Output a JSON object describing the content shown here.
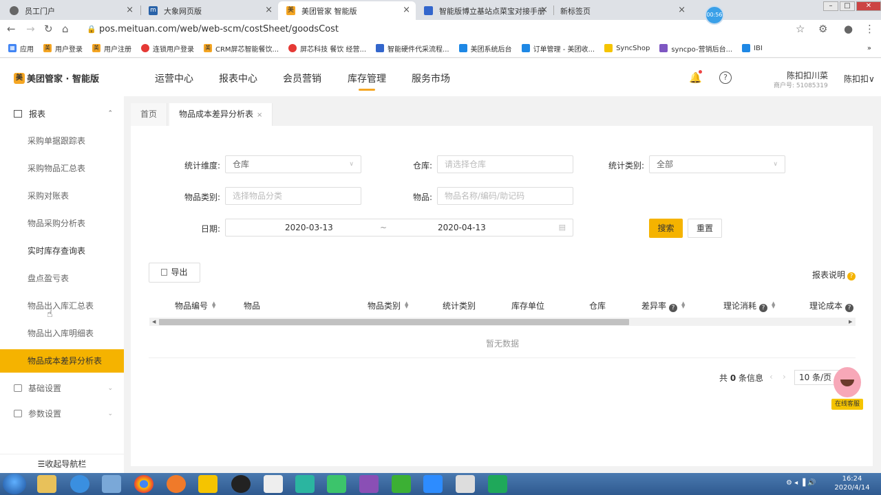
{
  "browser": {
    "tabs": [
      {
        "title": "员工门户"
      },
      {
        "title": "大象网页版"
      },
      {
        "title": "美团管家 智能版"
      },
      {
        "title": "智能版博立基站点菜宝对接手册"
      },
      {
        "title": "新标签页"
      }
    ],
    "timer": "00:56",
    "url": "pos.meituan.com/web/web-scm/costSheet/goodsCost",
    "bookmarks": [
      {
        "label": "应用"
      },
      {
        "label": "用户登录"
      },
      {
        "label": "用户注册"
      },
      {
        "label": "连锁用户登录"
      },
      {
        "label": "CRM屏芯智能餐饮..."
      },
      {
        "label": "屏芯科技 餐饮 经营..."
      },
      {
        "label": "智能硬件代采流程..."
      },
      {
        "label": "美团系统后台"
      },
      {
        "label": "订单管理 - 美团收..."
      },
      {
        "label": "SyncShop"
      },
      {
        "label": "syncpo-营销后台..."
      },
      {
        "label": "IBI"
      }
    ],
    "more": "»"
  },
  "header": {
    "logo": "美团管家 · 智能版",
    "nav": [
      "运营中心",
      "报表中心",
      "会员营销",
      "库存管理",
      "服务市场"
    ],
    "active_nav": "库存管理",
    "user_name": "陈扣扣川菜",
    "shop_id": "商户号: 51085319",
    "user_menu": "陈扣扣"
  },
  "sidebar": {
    "group": "报表",
    "items": [
      "采购单据跟踪表",
      "采购物品汇总表",
      "采购对账表",
      "物品采购分析表",
      "实时库存查询表",
      "盘点盈亏表",
      "物品出入库汇总表",
      "物品出入库明细表",
      "物品成本差异分析表"
    ],
    "selected": "物品成本差异分析表",
    "groups": [
      "基础设置",
      "参数设置"
    ],
    "collapse": "收起导航栏"
  },
  "content_tabs": [
    {
      "label": "首页"
    },
    {
      "label": "物品成本差异分析表"
    }
  ],
  "filters": {
    "dimension_label": "统计维度:",
    "dimension_value": "仓库",
    "warehouse_label": "仓库:",
    "warehouse_placeholder": "请选择仓库",
    "stat_type_label": "统计类别:",
    "stat_type_value": "全部",
    "category_label": "物品类别:",
    "category_placeholder": "选择物品分类",
    "item_label": "物品:",
    "item_placeholder": "物品名称/编码/助记码",
    "date_label": "日期:",
    "date_start": "2020-03-13",
    "date_sep": "~",
    "date_end": "2020-04-13",
    "search": "搜索",
    "reset": "重置"
  },
  "table": {
    "export": "导出",
    "explain": "报表说明",
    "columns": [
      "物品编号",
      "物品",
      "物品类别",
      "统计类别",
      "库存单位",
      "仓库",
      "差异率",
      "理论消耗",
      "理论成本"
    ],
    "empty": "暂无数据"
  },
  "pagination": {
    "total_prefix": "共",
    "total": "0",
    "total_suffix": "条信息",
    "page_size": "10 条/页"
  },
  "service": "在线客服",
  "clock": {
    "time": "16:24",
    "date": "2020/4/14"
  }
}
